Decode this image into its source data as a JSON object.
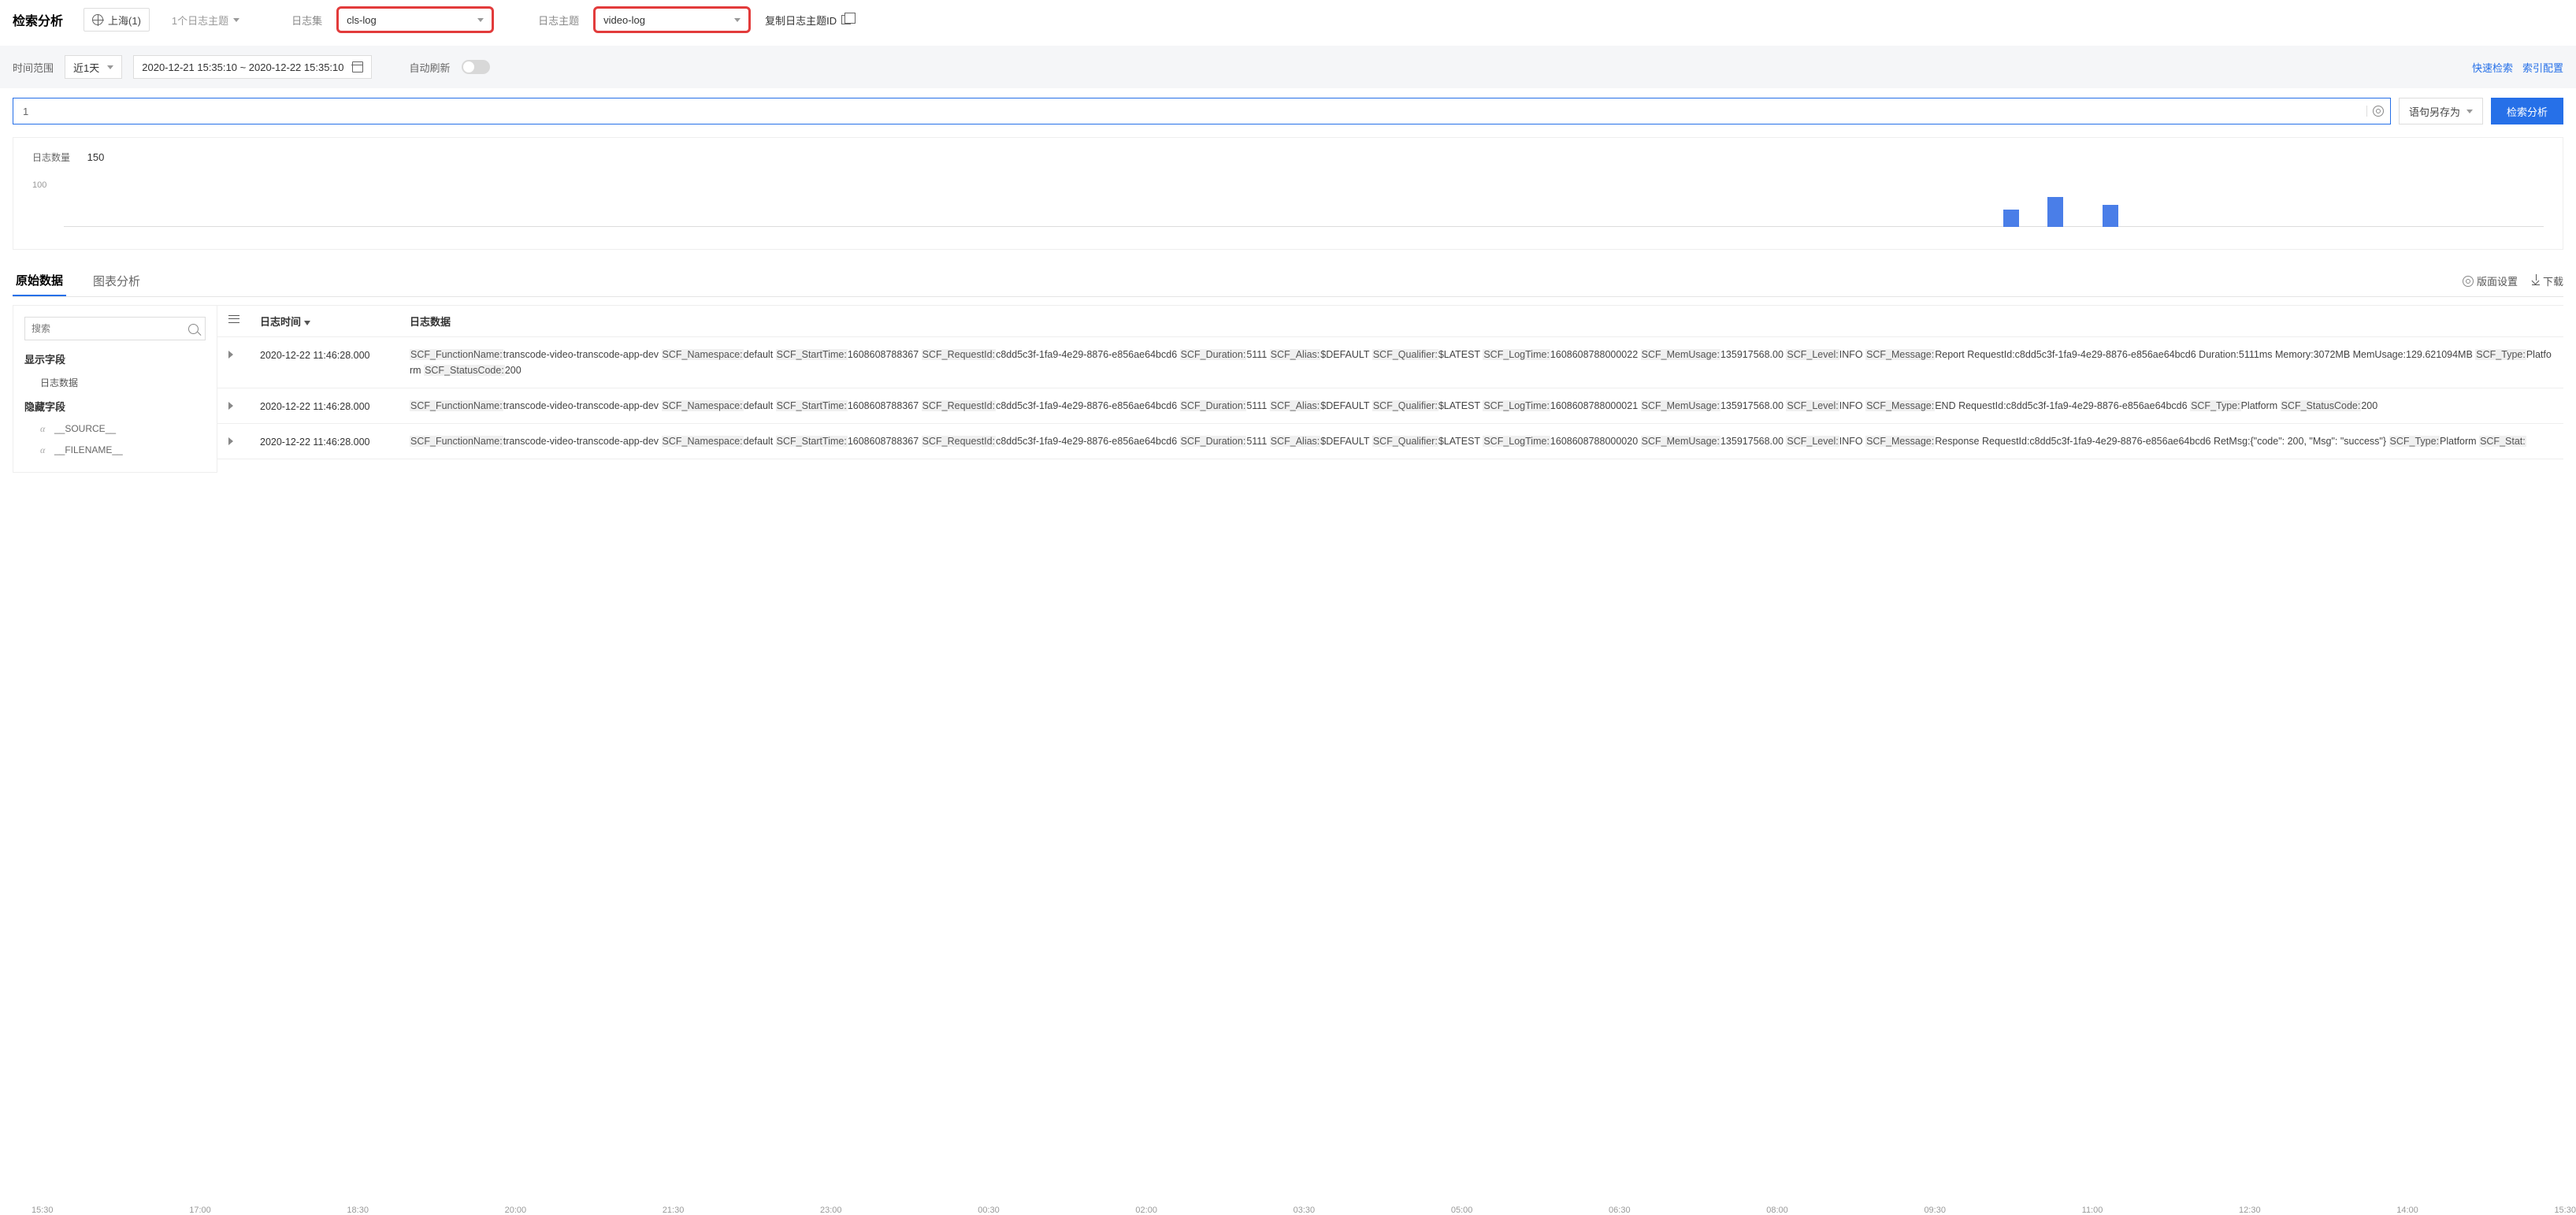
{
  "header": {
    "title": "检索分析",
    "region": "上海(1)",
    "topic_count": "1个日志主题",
    "logset_label": "日志集",
    "logset_value": "cls-log",
    "topic_label": "日志主题",
    "topic_value": "video-log",
    "copy_topic_id": "复制日志主题ID"
  },
  "filter": {
    "range_label": "时间范围",
    "range_preset": "近1天",
    "range_value": "2020-12-21 15:35:10 ~ 2020-12-22 15:35:10",
    "auto_refresh": "自动刷新",
    "quick_search": "快速检索",
    "index_config": "索引配置"
  },
  "search": {
    "query": "1",
    "save_as": "语句另存为",
    "go": "检索分析"
  },
  "chart_data": {
    "type": "bar",
    "count_label": "日志数量",
    "count_value": "150",
    "yticks": [
      100
    ],
    "xticks": [
      "15:30",
      "17:00",
      "18:30",
      "20:00",
      "21:30",
      "23:00",
      "00:30",
      "02:00",
      "03:30",
      "05:00",
      "06:30",
      "08:00",
      "09:30",
      "11:00",
      "12:30",
      "14:00",
      "15:30"
    ],
    "bars": [
      {
        "x_pct": 78.2,
        "h": 22
      },
      {
        "x_pct": 80.0,
        "h": 38
      },
      {
        "x_pct": 82.2,
        "h": 28
      }
    ]
  },
  "tabs": {
    "raw": "原始数据",
    "chart": "图表分析",
    "layout": "版面设置",
    "download": "下载"
  },
  "sidebar": {
    "search_placeholder": "搜索",
    "show_fields": "显示字段",
    "log_data": "日志数据",
    "hide_fields": "隐藏字段",
    "f_source": "__SOURCE__",
    "f_filename": "__FILENAME__"
  },
  "table": {
    "col_time": "日志时间",
    "col_data": "日志数据",
    "rows": [
      {
        "time": "2020-12-22 11:46:28.000",
        "kv": [
          [
            "SCF_FunctionName",
            "transcode-video-transcode-app-dev"
          ],
          [
            "SCF_Namespace",
            "default"
          ],
          [
            "SCF_StartTime",
            "1608608788367"
          ],
          [
            "SCF_RequestId",
            "c8dd5c3f-1fa9-4e29-8876-e856ae64bcd6"
          ],
          [
            "SCF_Duration",
            "5111"
          ],
          [
            "SCF_Alias",
            "$DEFAULT"
          ],
          [
            "SCF_Qualifier",
            "$LATEST"
          ],
          [
            "SCF_LogTime",
            "1608608788000022"
          ],
          [
            "SCF_MemUsage",
            "135917568.00"
          ],
          [
            "SCF_Level",
            "INFO"
          ],
          [
            "SCF_Message",
            "Report RequestId:c8dd5c3f-1fa9-4e29-8876-e856ae64bcd6 Duration:5111ms Memory:3072MB MemUsage:129.621094MB"
          ],
          [
            "SCF_Type",
            "Platform"
          ],
          [
            "SCF_StatusCode",
            "200"
          ]
        ]
      },
      {
        "time": "2020-12-22 11:46:28.000",
        "kv": [
          [
            "SCF_FunctionName",
            "transcode-video-transcode-app-dev"
          ],
          [
            "SCF_Namespace",
            "default"
          ],
          [
            "SCF_StartTime",
            "1608608788367"
          ],
          [
            "SCF_RequestId",
            "c8dd5c3f-1fa9-4e29-8876-e856ae64bcd6"
          ],
          [
            "SCF_Duration",
            "5111"
          ],
          [
            "SCF_Alias",
            "$DEFAULT"
          ],
          [
            "SCF_Qualifier",
            "$LATEST"
          ],
          [
            "SCF_LogTime",
            "1608608788000021"
          ],
          [
            "SCF_MemUsage",
            "135917568.00"
          ],
          [
            "SCF_Level",
            "INFO"
          ],
          [
            "SCF_Message",
            "END RequestId:c8dd5c3f-1fa9-4e29-8876-e856ae64bcd6"
          ],
          [
            "SCF_Type",
            "Platform"
          ],
          [
            "SCF_StatusCode",
            "200"
          ]
        ]
      },
      {
        "time": "2020-12-22 11:46:28.000",
        "kv": [
          [
            "SCF_FunctionName",
            "transcode-video-transcode-app-dev"
          ],
          [
            "SCF_Namespace",
            "default"
          ],
          [
            "SCF_StartTime",
            "1608608788367"
          ],
          [
            "SCF_RequestId",
            "c8dd5c3f-1fa9-4e29-8876-e856ae64bcd6"
          ],
          [
            "SCF_Duration",
            "5111"
          ],
          [
            "SCF_Alias",
            "$DEFAULT"
          ],
          [
            "SCF_Qualifier",
            "$LATEST"
          ],
          [
            "SCF_LogTime",
            "1608608788000020"
          ],
          [
            "SCF_MemUsage",
            "135917568.00"
          ],
          [
            "SCF_Level",
            "INFO"
          ],
          [
            "SCF_Message",
            "Response RequestId:c8dd5c3f-1fa9-4e29-8876-e856ae64bcd6 RetMsg:{\"code\": 200, \"Msg\": \"success\"}"
          ],
          [
            "SCF_Type",
            "Platform"
          ],
          [
            "SCF_Stat",
            ""
          ]
        ]
      }
    ]
  }
}
